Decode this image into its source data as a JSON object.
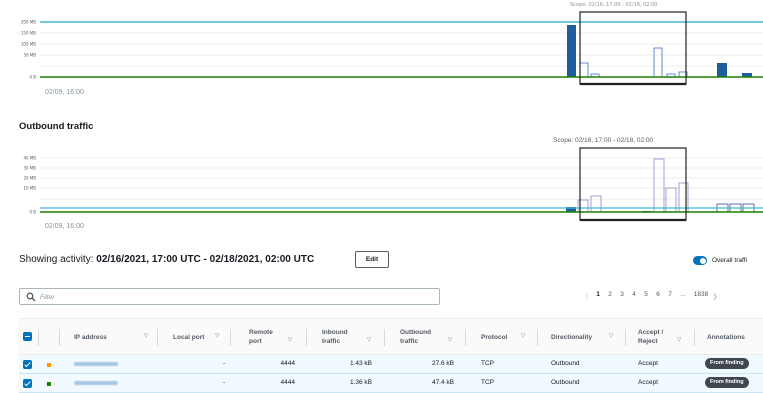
{
  "inbound_chart": {
    "y_ticks": [
      "200 MB",
      "150 MB",
      "100 MB",
      "50 MB",
      "0 B"
    ],
    "x_start_label": "02/09, 16:00"
  },
  "outbound_chart": {
    "title": "Outbound traffic",
    "scope_label": "Scope: 02/16, 17:00 - 02/18, 02:00",
    "y_ticks": [
      "40 MB",
      "30 MB",
      "20 MB",
      "10 MB",
      "0 B"
    ],
    "x_start_label": "02/09, 16:00"
  },
  "activity": {
    "prefix": "Showing activity:",
    "range": "02/16/2021, 17:00 UTC - 02/18/2021, 02:00 UTC",
    "edit_label": "Edit",
    "toggle_label": "Overall traffi"
  },
  "filter": {
    "placeholder": "Filter"
  },
  "pagination": {
    "prev": "〈",
    "pages": [
      "1",
      "2",
      "3",
      "4",
      "5",
      "6",
      "7",
      "...",
      "1838"
    ],
    "current": "1",
    "next": "〉"
  },
  "table": {
    "headers": {
      "ip": "IP address",
      "local_port": "Local port",
      "remote_port_1": "Remote",
      "remote_port_2": "port",
      "inbound_1": "Inbound",
      "inbound_2": "traffic",
      "outbound_1": "Outbound",
      "outbound_2": "traffic",
      "protocol": "Protocol",
      "directionality": "Directionality",
      "accept_1": "Accept /",
      "accept_2": "Reject",
      "annotations": "Annotations"
    },
    "sort_glyph": "▽",
    "rows": [
      {
        "swatch_color": "#ff9900",
        "local_port": "-",
        "remote_port": "4444",
        "inbound": "1.43 kB",
        "outbound": "27.6 kB",
        "protocol": "TCP",
        "directionality": "Outbound",
        "accept": "Accept",
        "annotation": "From finding"
      },
      {
        "swatch_color": "#1d8102",
        "local_port": "-",
        "remote_port": "4444",
        "inbound": "1.36 kB",
        "outbound": "47.4 kB",
        "protocol": "TCP",
        "directionality": "Outbound",
        "accept": "Accept",
        "annotation": "From finding"
      }
    ]
  },
  "colors": {
    "accent": "#0073bb",
    "baseline_green": "#1d8102",
    "baseline_blue": "#44b9d6",
    "bar_dark": "#1f5e9e",
    "bar_outline": "#3a6fc4"
  }
}
